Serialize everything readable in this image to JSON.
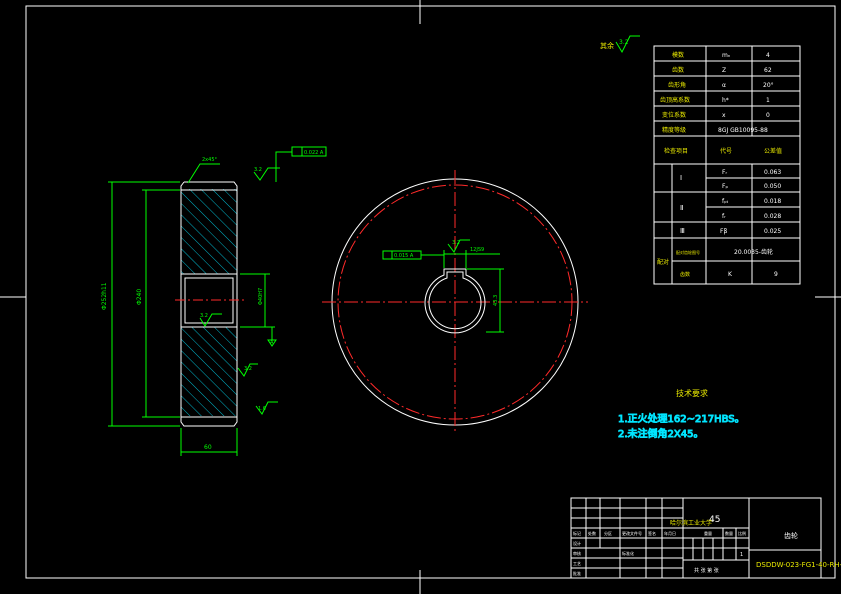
{
  "drawing": {
    "material": "45",
    "part_name": "齿轮",
    "drawing_number": "DSDDW-023-FG1-40-RH-42",
    "title_inline": "哈尔滨工业大学",
    "title_sub": "共 张 第 张",
    "scale_label": "比例",
    "weight_label": "重量",
    "count_label": "数量",
    "scale_value": "1",
    "title_rows": [
      "标记",
      "处数",
      "分区",
      "更改文件号",
      "签名",
      "年月日"
    ],
    "title_left": [
      "设计",
      "审核",
      "工艺",
      "标准化",
      "批准"
    ]
  },
  "surface_note": {
    "label": "其余",
    "value": "3.2"
  },
  "parameters": {
    "rows": [
      {
        "name": "模数",
        "sym": "mₙ",
        "val": "4"
      },
      {
        "name": "齿数",
        "sym": "Z",
        "val": "62"
      },
      {
        "name": "齿形角",
        "sym": "α",
        "val": "20°"
      },
      {
        "name": "齿顶高系数",
        "sym": "h*",
        "val": "1"
      },
      {
        "name": "变位系数",
        "sym": "x",
        "val": "0"
      },
      {
        "name": "精度等级",
        "sym": "",
        "val": "8GJ GB10095-88"
      }
    ],
    "check_header": {
      "name": "检查项目",
      "sym": "代号",
      "val": "公差值"
    },
    "groups": [
      {
        "label": "Ⅰ",
        "items": [
          {
            "sym": "Fᵣ",
            "val": "0.063"
          },
          {
            "sym": "Fₚ",
            "val": "0.050"
          }
        ]
      },
      {
        "label": "Ⅱ",
        "items": [
          {
            "sym": "fₚₜ",
            "val": "0.018"
          },
          {
            "sym": "fᵣ",
            "val": "0.028"
          }
        ]
      },
      {
        "label": "Ⅲ",
        "items": [
          {
            "sym": "Fβ",
            "val": "0.025"
          }
        ]
      }
    ],
    "pair": {
      "label": "配对",
      "row1_name": "配对齿轮图号",
      "row1_val": "20.0035-齿轮",
      "row2_name": "齿数",
      "row2_sym": "K",
      "row2_val": "9"
    }
  },
  "tech_notes": {
    "title": "技术要求",
    "lines": [
      "1.正火处理162~217HBS。",
      "2.未注倒角2X45。"
    ]
  },
  "side_view": {
    "od_label": "Φ252h11",
    "root_label": "Φ240",
    "bore_label": "Φ40H7",
    "width_label": "60",
    "chamfer_label": "2x45°",
    "runout_box": "0.022 A",
    "roughness": [
      "3.2",
      "3.2",
      "3.2",
      "1.6",
      "3.2"
    ],
    "datum": "A"
  },
  "front_view": {
    "keyway_width": "12JS9",
    "keyway_depth": "43.3",
    "sym_tol": "0.015 A",
    "roughness": "3.2"
  }
}
